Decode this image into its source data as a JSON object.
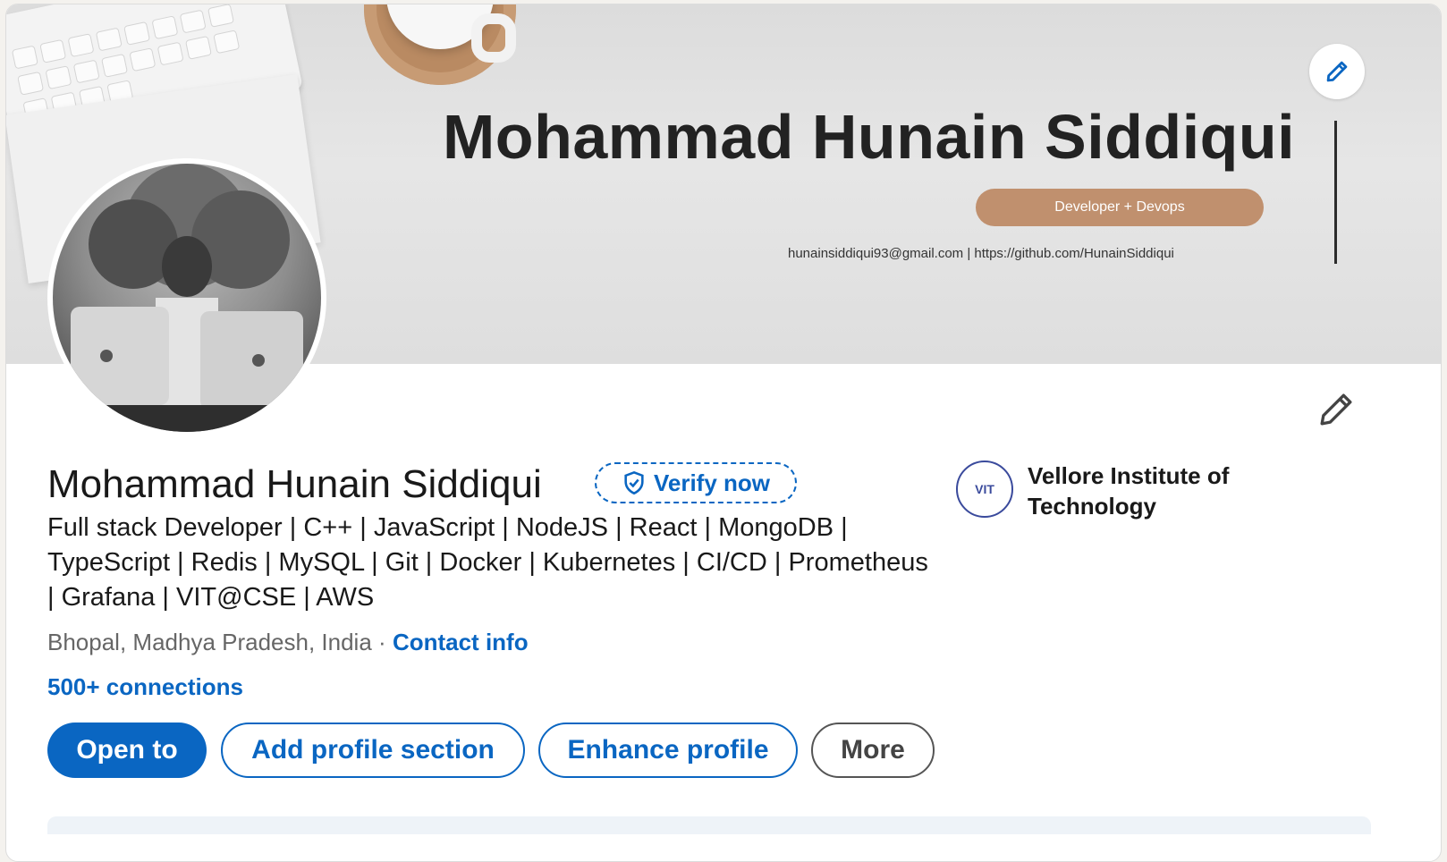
{
  "banner": {
    "title": "Mohammad Hunain Siddiqui",
    "tag": "Developer + Devops",
    "contact": "hunainsiddiqui93@gmail.com  |  https://github.com/HunainSiddiqui",
    "edit_icon": "pencil-icon"
  },
  "profile": {
    "name": "Mohammad Hunain Siddiqui",
    "verify_label": "Verify now",
    "verify_icon": "shield-check-icon",
    "headline": "Full stack Developer | C++ | JavaScript | NodeJS | React | MongoDB | TypeScript | Redis | MySQL | Git | Docker | Kubernetes | CI/CD | Prometheus | Grafana | VIT@CSE | AWS",
    "location": "Bhopal, Madhya Pradesh, India",
    "separator": "·",
    "contact_info": "Contact info",
    "connections": "500+ connections",
    "edit_icon": "pencil-icon"
  },
  "education": {
    "school": "Vellore Institute of Technology",
    "logo_text": "VIT"
  },
  "actions": {
    "open_to": "Open to",
    "add_section": "Add profile section",
    "enhance": "Enhance profile",
    "more": "More"
  },
  "colors": {
    "accent": "#0a66c2",
    "banner_pill": "#c0906e"
  }
}
